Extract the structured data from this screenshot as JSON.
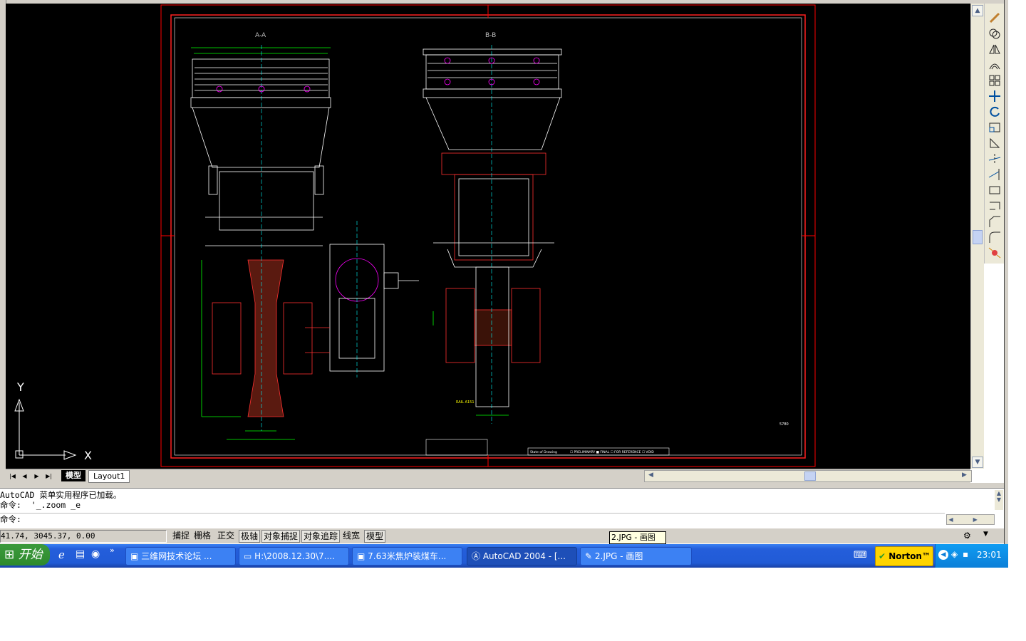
{
  "drawing": {
    "section_a": "A-A",
    "section_b": "B-B",
    "rail_label": "RAIL A151",
    "state_label": "State of Drawing",
    "state_options": "☐ PRELIMINARY  ■ FINAL  ☐ FOR REFERENCE  ☐ VOID",
    "scale_note": "5780"
  },
  "ucs": {
    "x_label": "X",
    "y_label": "Y"
  },
  "layout_tabs": [
    {
      "label": "模型"
    },
    {
      "label": "Layout1"
    }
  ],
  "command": {
    "lines": [
      "AutoCAD 菜单实用程序已加载。",
      "命令:  '_.zoom _e"
    ],
    "prompt": "命令:"
  },
  "status": {
    "coords": "41.74, 3045.37, 0.00",
    "toggles": [
      "捕捉",
      "栅格",
      "正交",
      "极轴",
      "对象捕捉",
      "对象追踪",
      "线宽",
      "模型"
    ]
  },
  "taskbar": {
    "start": "开始",
    "tasks": [
      "三维网技术论坛 ...",
      "H:\\2008.12.30\\7....",
      "7.63米焦炉装煤车...",
      "AutoCAD 2004 - [...",
      "2.JPG - 画图"
    ],
    "norton": "Norton™",
    "clock": "23:01"
  },
  "tooltip": "2.JPG - 画图",
  "colors": {
    "taskbar": "#245edb",
    "start": "#3c9a3c",
    "canvas": "#000000"
  }
}
